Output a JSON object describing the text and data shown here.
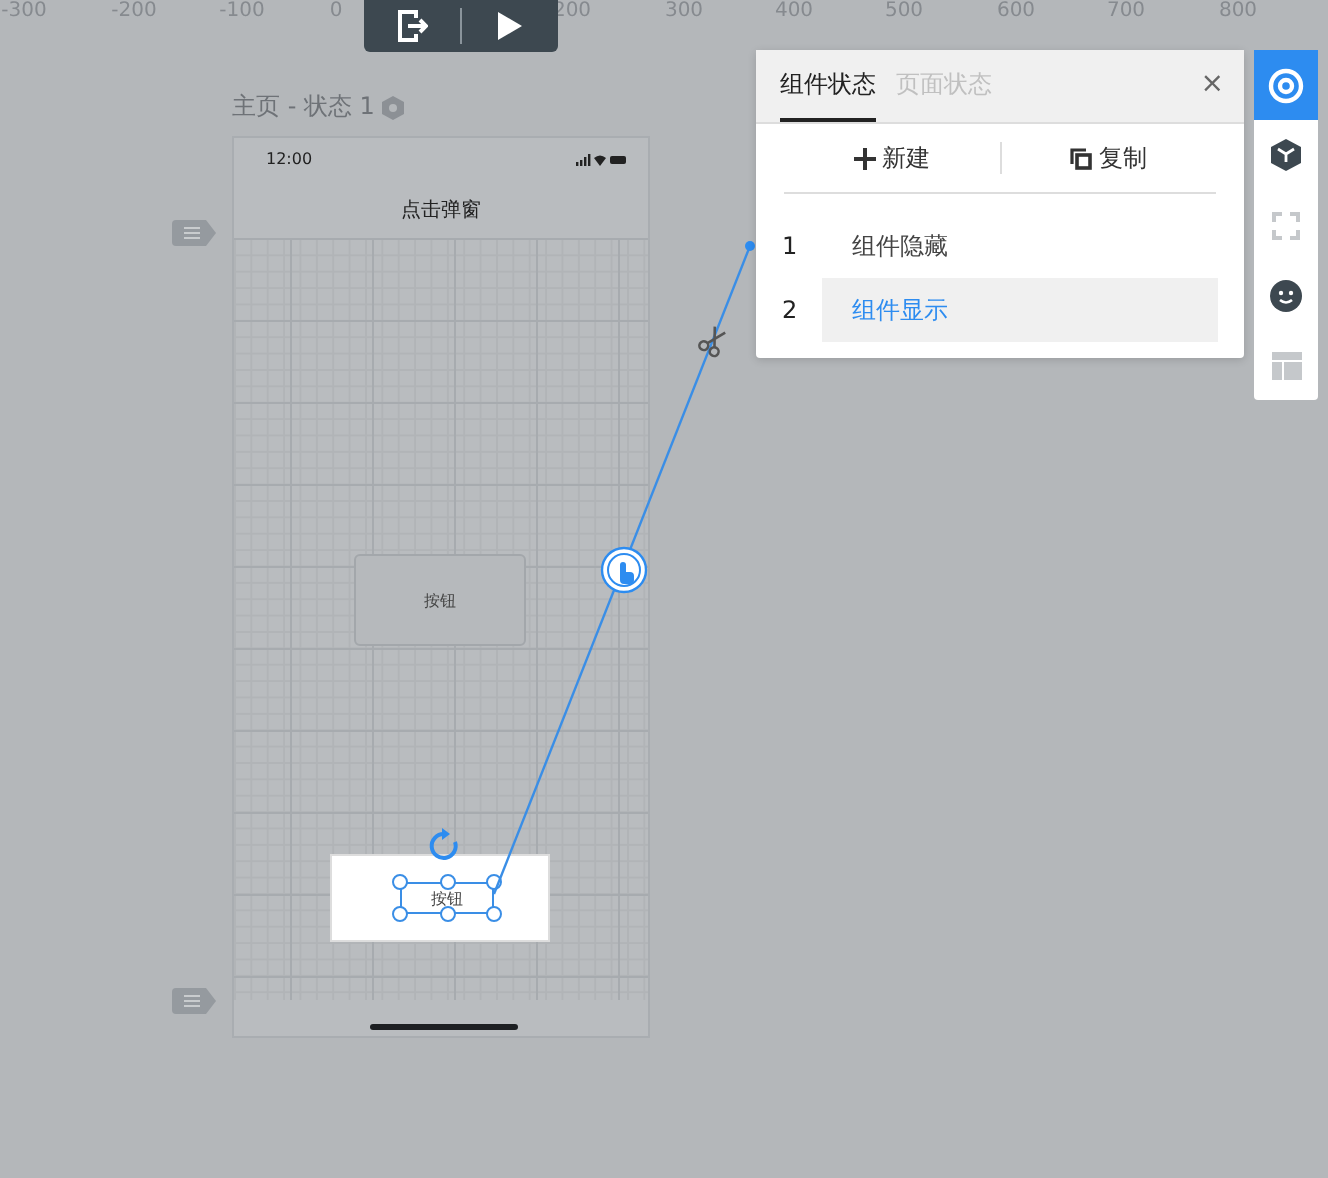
{
  "ruler": {
    "labels": [
      "-300",
      "-200",
      "-100",
      "0",
      "200",
      "300",
      "400",
      "500",
      "600",
      "700",
      "800"
    ]
  },
  "page": {
    "title": "主页 - 状态 1",
    "status_time": "12:00",
    "header": "点击弹窗",
    "buttons": [
      {
        "label": "按钮",
        "selected": false
      },
      {
        "label": "按钮",
        "selected": true
      }
    ]
  },
  "panel": {
    "tabs": [
      {
        "label": "组件状态",
        "selected": true
      },
      {
        "label": "页面状态",
        "selected": false
      }
    ],
    "close": "×",
    "actions": [
      {
        "kind": "new",
        "label": "新建"
      },
      {
        "kind": "copy",
        "label": "复制"
      }
    ],
    "states": [
      {
        "number": "1",
        "label": "组件隐藏",
        "selected": false
      },
      {
        "number": "2",
        "label": "组件显示",
        "selected": true
      }
    ]
  },
  "side_toolbar": {
    "items": [
      {
        "kind": "target",
        "selected": true
      },
      {
        "kind": "cube",
        "selected": false
      },
      {
        "kind": "frame",
        "selected": false
      },
      {
        "kind": "smiley",
        "selected": false
      },
      {
        "kind": "layout",
        "selected": false
      }
    ]
  }
}
